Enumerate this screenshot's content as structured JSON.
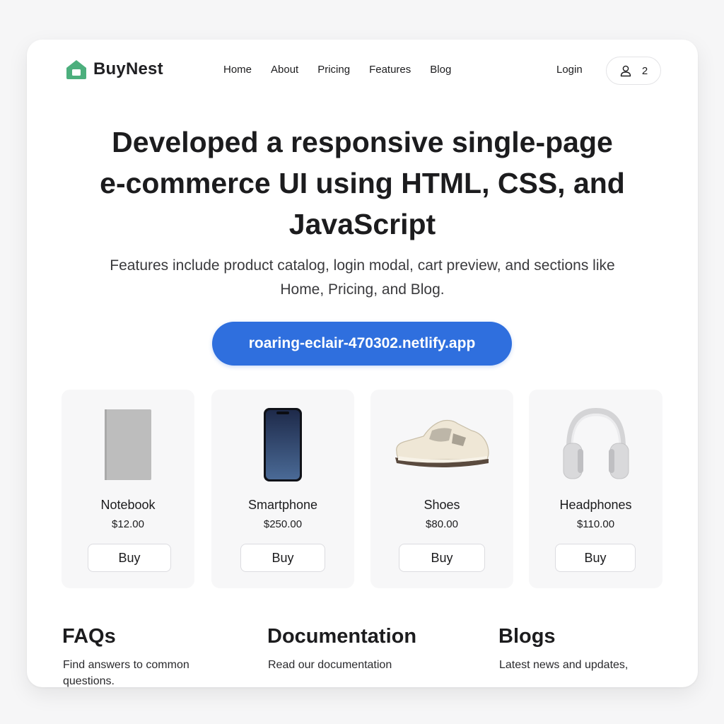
{
  "brand": {
    "name": "BuyNest",
    "accent": "#4caf7d"
  },
  "nav": {
    "items": [
      "Home",
      "About",
      "Pricing",
      "Features",
      "Blog"
    ]
  },
  "header": {
    "login_label": "Login",
    "cart_count": "2"
  },
  "hero": {
    "title": "Developed a responsive single-page e-commerce UI using HTML, CSS, and JavaScript",
    "subtitle": "Features include product catalog, login modal, cart preview,  and sections like Home, Pricing, and Blog.",
    "url_button": "roaring-eclair-470302.netlify.app",
    "url_button_color": "#2f6fde"
  },
  "products": [
    {
      "name": "Notebook",
      "price": "$12.00",
      "buy_label": "Buy",
      "icon": "notebook-icon"
    },
    {
      "name": "Smartphone",
      "price": "$250.00",
      "buy_label": "Buy",
      "icon": "smartphone-icon"
    },
    {
      "name": "Shoes",
      "price": "$80.00",
      "buy_label": "Buy",
      "icon": "shoes-icon"
    },
    {
      "name": "Headphones",
      "price": "$110.00",
      "buy_label": "Buy",
      "icon": "headphones-icon"
    }
  ],
  "sections": [
    {
      "title": "FAQs",
      "text": "Find answers to common questions."
    },
    {
      "title": "Documentation",
      "text": "Read our documentation"
    },
    {
      "title": "Blogs",
      "text": "Latest news  and updates,"
    }
  ]
}
